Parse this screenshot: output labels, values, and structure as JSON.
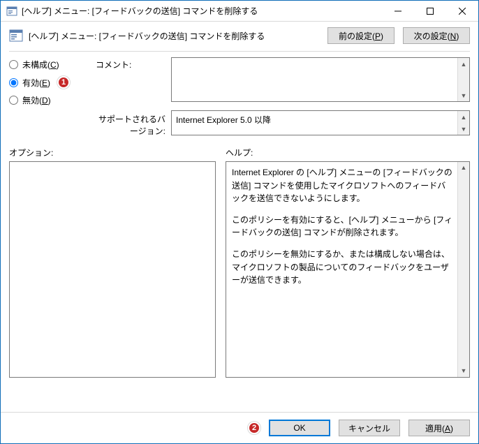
{
  "window": {
    "title": "[ヘルプ] メニュー: [フィードバックの送信] コマンドを削除する"
  },
  "header": {
    "title": "[ヘルプ] メニュー: [フィードバックの送信] コマンドを削除する",
    "prev_btn": "前の設定(P)",
    "next_btn": "次の設定(N)"
  },
  "radios": {
    "not_configured": "未構成(C)",
    "enabled": "有効(E)",
    "disabled": "無効(D)",
    "selected": "enabled"
  },
  "annotations": {
    "radio_badge": "1",
    "ok_badge": "2"
  },
  "comment": {
    "label": "コメント:",
    "value": ""
  },
  "supported": {
    "label": "サポートされるバージョン:",
    "value": "Internet Explorer 5.0 以降"
  },
  "sections": {
    "options_label": "オプション:",
    "help_label": "ヘルプ:"
  },
  "help_text": {
    "p1": "Internet Explorer の [ヘルプ] メニューの [フィードバックの送信] コマンドを使用したマイクロソフトへのフィードバックを送信できないようにします。",
    "p2": "このポリシーを有効にすると、[ヘルプ] メニューから [フィードバックの送信] コマンドが削除されます。",
    "p3": "このポリシーを無効にするか、または構成しない場合は、マイクロソフトの製品についてのフィードバックをユーザーが送信できます。"
  },
  "footer": {
    "ok": "OK",
    "cancel": "キャンセル",
    "apply": "適用(A)"
  }
}
